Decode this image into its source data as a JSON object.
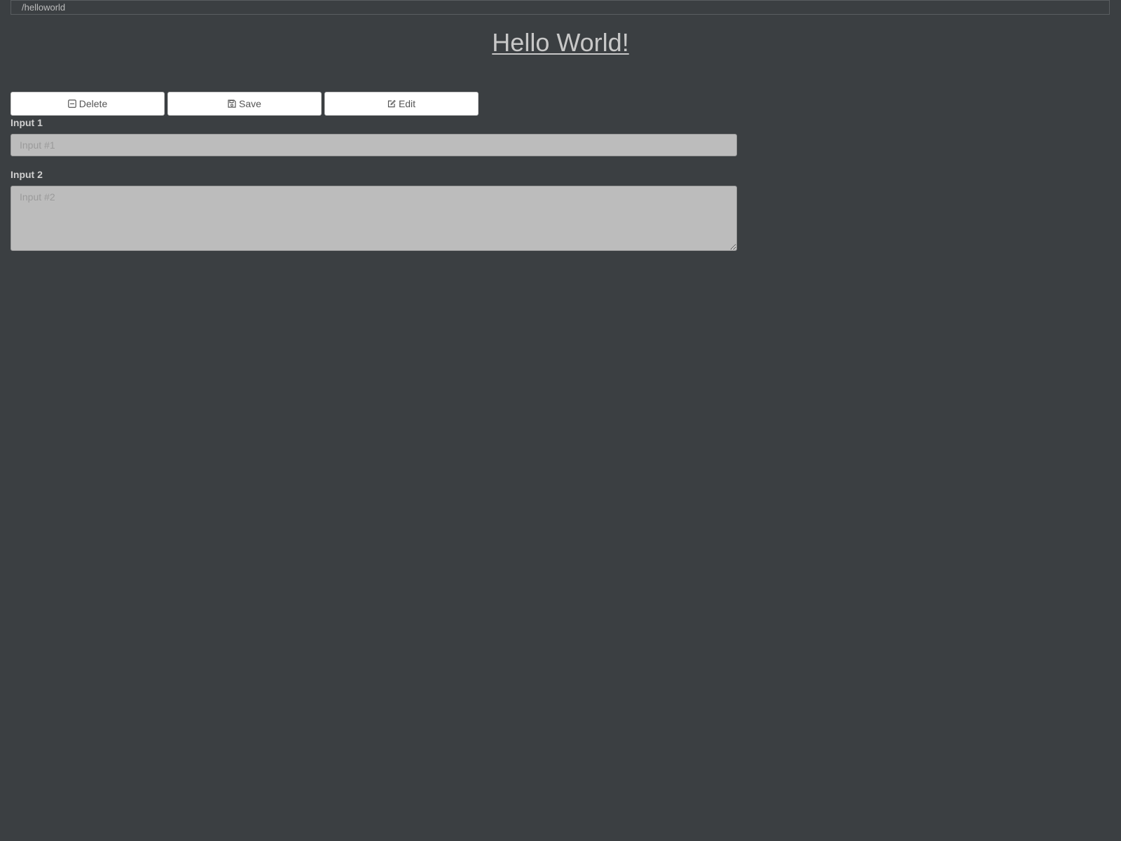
{
  "header": {
    "path": "/helloworld",
    "title": "Hello World!"
  },
  "toolbar": {
    "delete_label": "Delete",
    "delete_icon": "minus-square-icon",
    "save_label": "Save",
    "save_icon": "floppy-disk-icon",
    "edit_label": "Edit",
    "edit_icon": "pencil-square-icon"
  },
  "form": {
    "input1": {
      "label": "Input 1",
      "placeholder": "Input #1",
      "value": ""
    },
    "input2": {
      "label": "Input 2",
      "placeholder": "Input #2",
      "value": ""
    }
  },
  "colors": {
    "background": "#3b3f42",
    "field_background": "#bcbcbc",
    "button_background": "#ffffff"
  }
}
